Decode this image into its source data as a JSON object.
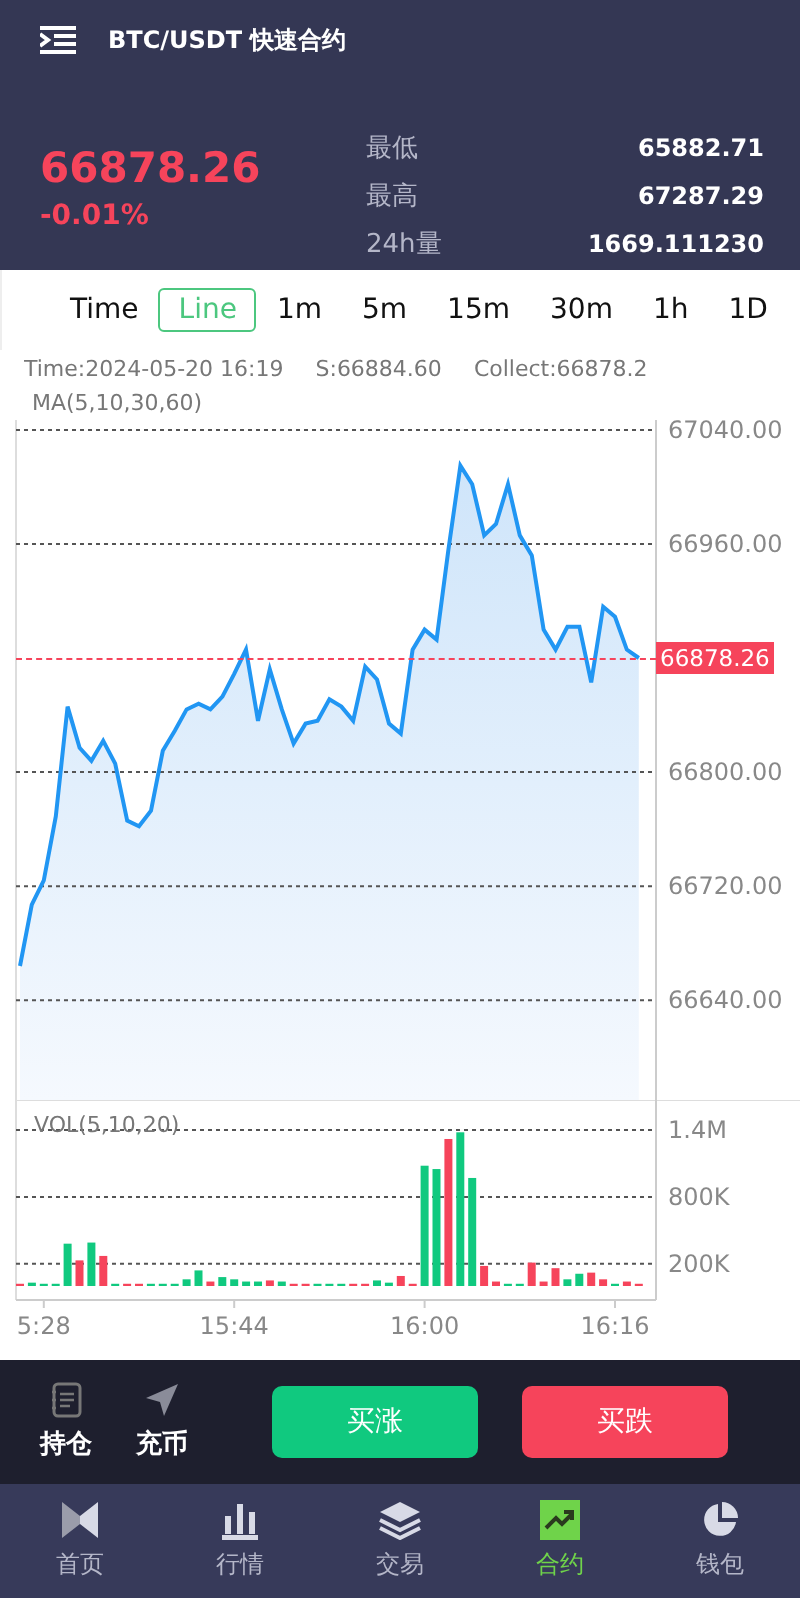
{
  "header": {
    "title": "BTC/USDT 快速合约"
  },
  "ticker": {
    "price": "66878.26",
    "change": "-0.01%",
    "stats": [
      {
        "label": "最低",
        "value": "65882.71"
      },
      {
        "label": "最高",
        "value": "67287.29"
      },
      {
        "label": "24h量",
        "value": "1669.111230"
      }
    ]
  },
  "intervals": [
    {
      "label": "Time",
      "selected": false
    },
    {
      "label": "Line",
      "selected": true
    },
    {
      "label": "1m",
      "selected": false
    },
    {
      "label": "5m",
      "selected": false
    },
    {
      "label": "15m",
      "selected": false
    },
    {
      "label": "30m",
      "selected": false
    },
    {
      "label": "1h",
      "selected": false
    },
    {
      "label": "1D",
      "selected": false
    }
  ],
  "chart_info": {
    "time": "Time:2024-05-20 16:19",
    "s": "S:66884.60",
    "collect": "Collect:66878.2",
    "ma": "MA(5,10,30,60)"
  },
  "price_chart": {
    "price_tag": "66878.26",
    "chart_data": {
      "type": "area",
      "grid": true,
      "ylim": [
        66570,
        67047
      ],
      "yticks": [
        {
          "value": 67040,
          "label": "67040.00"
        },
        {
          "value": 66960,
          "label": "66960.00"
        },
        {
          "value": 66800,
          "label": "66800.00"
        },
        {
          "value": 66720,
          "label": "66720.00"
        },
        {
          "value": 66640,
          "label": "66640.00"
        }
      ],
      "series": [
        {
          "color": "#2196f3",
          "values": [
            66664,
            66707,
            66724,
            66769,
            66846,
            66817,
            66808,
            66822,
            66806,
            66766,
            66762,
            66773,
            66815,
            66829,
            66844,
            66848,
            66844,
            66853,
            66869,
            66886,
            66836,
            66872,
            66844,
            66820,
            66834,
            66836,
            66851,
            66846,
            66836,
            66874,
            66865,
            66834,
            66827,
            66886,
            66900,
            66893,
            66956,
            67015,
            67002,
            66966,
            66974,
            67002,
            66966,
            66952,
            66900,
            66886,
            66902,
            66902,
            66863,
            66916,
            66909,
            66886,
            66880
          ]
        }
      ]
    }
  },
  "volume_chart": {
    "label": "VOL(5,10,20)",
    "chart_data": {
      "type": "bar",
      "grid": true,
      "ylim": [
        0,
        1670000
      ],
      "categories": [
        null,
        null,
        "5:28",
        null,
        null,
        null,
        null,
        null,
        null,
        null,
        null,
        null,
        null,
        null,
        null,
        null,
        null,
        null,
        "15:44",
        null,
        null,
        null,
        null,
        null,
        null,
        null,
        null,
        null,
        null,
        null,
        null,
        null,
        null,
        null,
        "16:00",
        null,
        null,
        null,
        null,
        null,
        null,
        null,
        null,
        null,
        null,
        null,
        null,
        null,
        null,
        null,
        "16:16",
        null,
        null
      ],
      "yticks": [
        {
          "value": 1400000,
          "label": "1.4M"
        },
        {
          "value": 800000,
          "label": "800K"
        },
        {
          "value": 200000,
          "label": "200K"
        }
      ],
      "series": [
        {
          "color": "#10c97f",
          "values": [
            null,
            30000,
            20000,
            20000,
            380000,
            null,
            390000,
            null,
            20000,
            null,
            null,
            20000,
            20000,
            20000,
            60000,
            140000,
            null,
            80000,
            60000,
            40000,
            40000,
            null,
            40000,
            null,
            null,
            20000,
            20000,
            20000,
            null,
            null,
            50000,
            30000,
            null,
            null,
            1080000,
            1050000,
            null,
            1380000,
            970000,
            null,
            null,
            20000,
            20000,
            null,
            null,
            null,
            60000,
            110000,
            null,
            null,
            20000,
            null,
            null
          ]
        },
        {
          "color": "#f6445b",
          "values": [
            20000,
            null,
            null,
            null,
            null,
            230000,
            null,
            270000,
            null,
            20000,
            20000,
            null,
            null,
            null,
            null,
            null,
            40000,
            null,
            null,
            null,
            null,
            50000,
            null,
            20000,
            20000,
            null,
            null,
            null,
            20000,
            20000,
            null,
            null,
            90000,
            20000,
            null,
            null,
            1320000,
            null,
            null,
            180000,
            40000,
            null,
            null,
            210000,
            40000,
            160000,
            null,
            null,
            120000,
            60000,
            null,
            40000,
            20000
          ]
        }
      ]
    }
  },
  "actions": [
    {
      "label": "持仓",
      "kind": "positions"
    },
    {
      "label": "充币",
      "kind": "deposit"
    }
  ],
  "trade_buttons": [
    {
      "label": "买涨",
      "kind": "buy"
    },
    {
      "label": "买跌",
      "kind": "sell"
    }
  ],
  "nav": [
    {
      "label": "首页",
      "kind": "home",
      "selected": false
    },
    {
      "label": "行情",
      "kind": "market",
      "selected": false
    },
    {
      "label": "交易",
      "kind": "trade",
      "selected": false
    },
    {
      "label": "合约",
      "kind": "contract",
      "selected": true
    },
    {
      "label": "钱包",
      "kind": "wallet",
      "selected": false
    }
  ]
}
